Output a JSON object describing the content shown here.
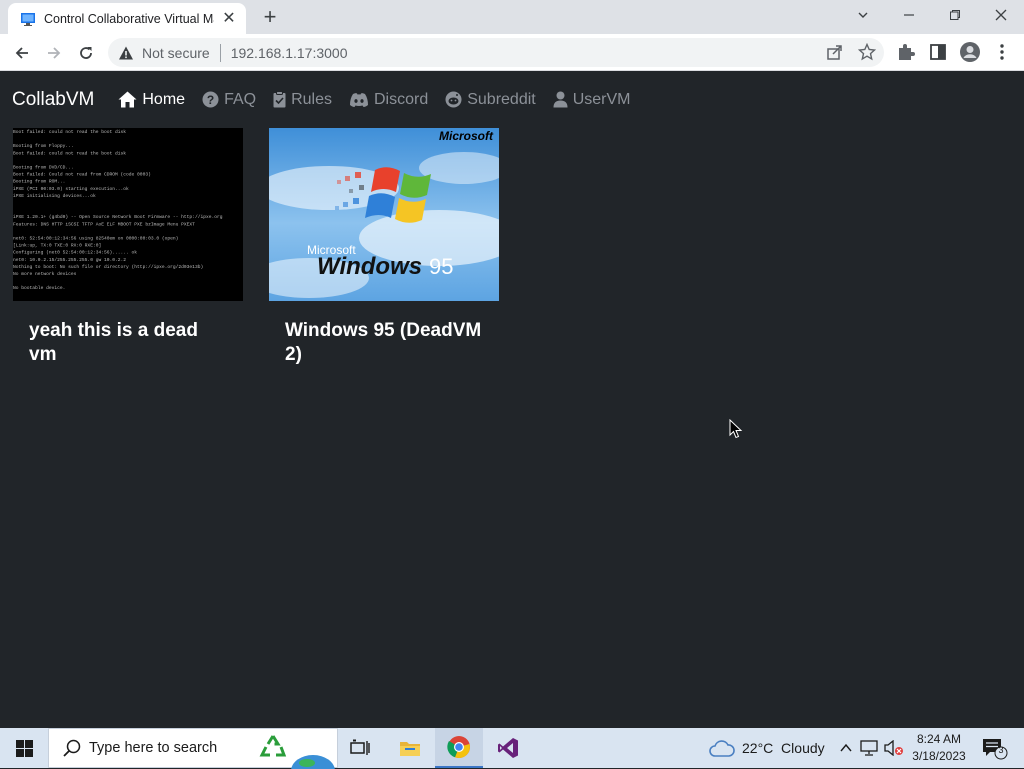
{
  "browser": {
    "tab_title": "Control Collaborative Virtual Machines",
    "security_label": "Not secure",
    "url": "192.168.1.17:3000"
  },
  "site": {
    "brand": "CollabVM",
    "nav": [
      {
        "label": "Home",
        "icon": "home-icon",
        "active": true
      },
      {
        "label": "FAQ",
        "icon": "question-circle-icon",
        "active": false
      },
      {
        "label": "Rules",
        "icon": "clipboard-check-icon",
        "active": false
      },
      {
        "label": "Discord",
        "icon": "discord-icon",
        "active": false
      },
      {
        "label": "Subreddit",
        "icon": "reddit-icon",
        "active": false
      },
      {
        "label": "UserVM",
        "icon": "user-icon",
        "active": false
      }
    ],
    "vms": [
      {
        "title": "yeah this is a dead vm",
        "thumbnail": "terminal-boot-screen"
      },
      {
        "title": "Windows 95 (DeadVM 2)",
        "thumbnail": "windows95-splash"
      }
    ]
  },
  "thumb_text": {
    "boot_lines": [
      "Boot failed: could not read the boot disk",
      "",
      "Booting from Floppy...",
      "Boot failed: could not read the boot disk",
      "",
      "Booting from DVD/CD...",
      "Boot failed: Could not read from CDROM (code 0003)",
      "Booting from ROM...",
      "iPXE (PCI 00:03.0) starting execution...ok",
      "iPXE initialising devices...ok",
      "",
      "",
      "iPXE 1.20.1+ (g4bd0) -- Open Source Network Boot Firmware -- http://ipxe.org",
      "Features: DNS HTTP iSCSI TFTP AoE ELF MBOOT PXE bzImage Menu PXEXT",
      "",
      "net0: 52:54:00:12:34:56 using 82540em on 0000:00:03.0 (open)",
      "  [Link:up, TX:0 TXE:0 RX:0 RXE:0]",
      "Configuring (net0 52:54:00:12:34:56)...... ok",
      "net0: 10.0.2.15/255.255.255.0 gw 10.0.2.2",
      "Nothing to boot: No such file or directory (http://ipxe.org/2d03e13b)",
      "No more network devices",
      "",
      "No bootable device."
    ],
    "win95_microsoft": "Microsoft",
    "win95_small": "Microsoft",
    "win95_windows": "Windows",
    "win95_version": "95"
  },
  "taskbar": {
    "search_placeholder": "Type here to search",
    "weather": "22°C  Cloudy",
    "time": "8:24 AM",
    "date": "3/18/2023",
    "notification_count": "3"
  },
  "colors": {
    "page_bg": "#212529",
    "nav_muted": "#8c9198",
    "taskbar_bg": "#d9e4f1"
  }
}
